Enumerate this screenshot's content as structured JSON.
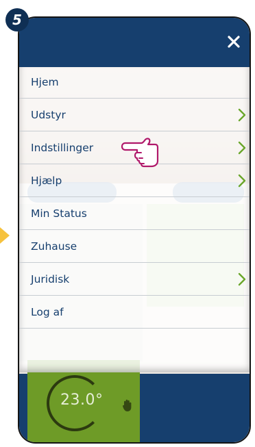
{
  "step": {
    "number": "5"
  },
  "header": {
    "close_icon": "close-icon"
  },
  "menu": {
    "items": [
      {
        "label": "Hjem",
        "has_chevron": false
      },
      {
        "label": "Udstyr",
        "has_chevron": true
      },
      {
        "label": "Indstillinger",
        "has_chevron": true
      },
      {
        "label": "Hjælp",
        "has_chevron": true
      },
      {
        "label": "Min Status",
        "has_chevron": false
      },
      {
        "label": "Zuhause",
        "has_chevron": false
      },
      {
        "label": "Juridisk",
        "has_chevron": true
      },
      {
        "label": "Log af",
        "has_chevron": false
      }
    ]
  },
  "background": {
    "temperature": "23.0°"
  },
  "colors": {
    "navy": "#163f6e",
    "chevron": "#6aa62b",
    "badge": "#0f2f54",
    "thermo_green": "#6e9b27",
    "arrow": "#f6c23e"
  }
}
